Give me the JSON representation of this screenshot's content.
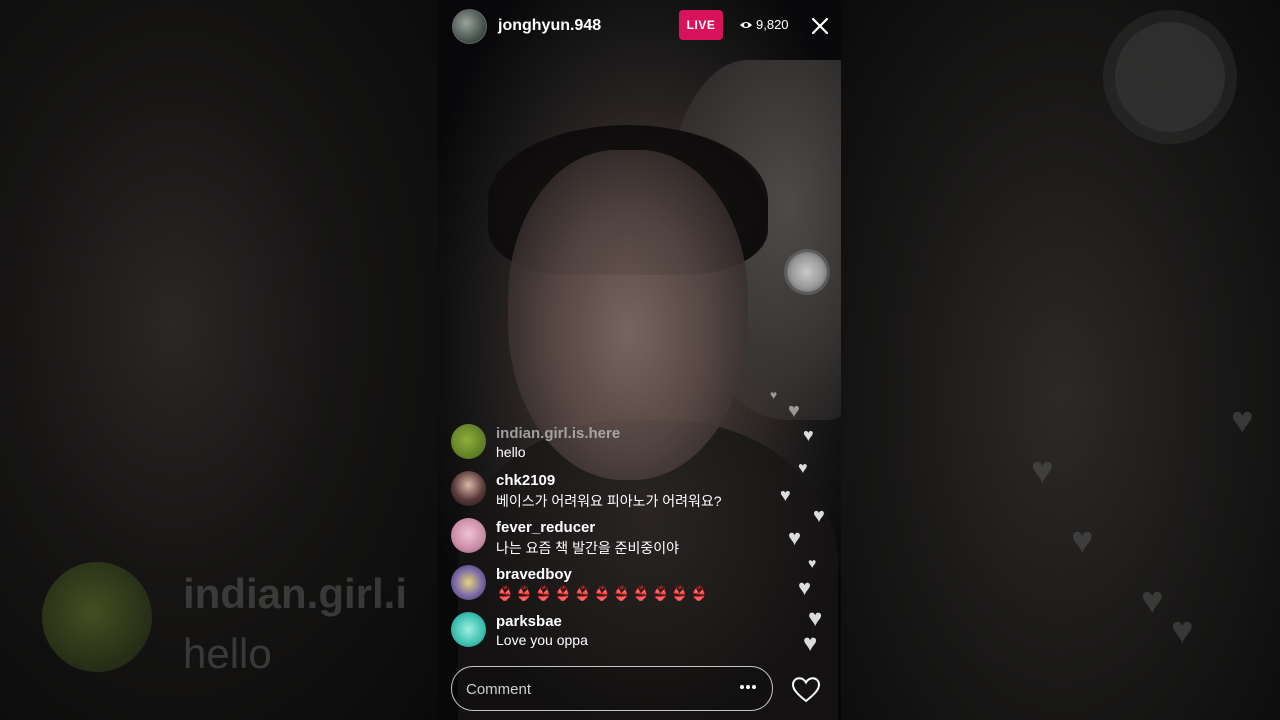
{
  "stream": {
    "username": "jonghyun.948",
    "live_label": "LIVE",
    "viewer_count": "9,820"
  },
  "comments": [
    {
      "user": "indian.girl.is.here",
      "text": "hello",
      "avatar_color": "#6f8f2e"
    },
    {
      "user": "chk2109",
      "text": "베이스가 어려워요 피아노가 어려워요?",
      "avatar_color": "#3b2a2a"
    },
    {
      "user": "fever_reducer",
      "text": "나는 요즘 책 발간을 준비중이야",
      "avatar_color": "#d79ab0"
    },
    {
      "user": "bravedboy",
      "text": "👙👙👙👙👙👙👙👙👙👙👙",
      "avatar_color": "#7a6a9a"
    },
    {
      "user": "parksbae",
      "text": "Love you oppa",
      "avatar_color": "#3dbfb0"
    }
  ],
  "ghost": {
    "username": "indian.girl.i",
    "text": "hello"
  },
  "composer": {
    "placeholder": "Comment"
  },
  "colors": {
    "live_badge": "#d8125b"
  }
}
